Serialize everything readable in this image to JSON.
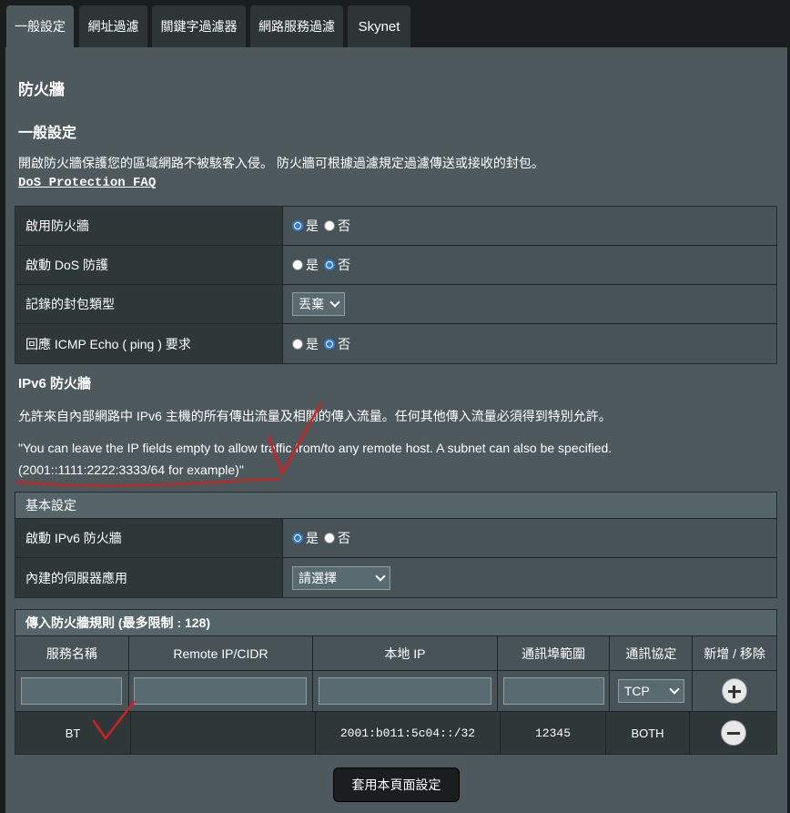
{
  "tabs": [
    "一般設定",
    "網址過濾",
    "關鍵字過濾器",
    "網路服務過濾",
    "Skynet"
  ],
  "page": {
    "title": "防火牆",
    "general_heading": "一般設定",
    "description": "開啟防火牆保護您的區域網路不被駭客入侵。 防火牆可根據過濾規定過濾傳送或接收的封包。",
    "faq_link": "DoS Protection FAQ"
  },
  "general_settings": [
    {
      "label": "啟用防火牆",
      "type": "radio",
      "options": [
        "是",
        "否"
      ],
      "selected": "是"
    },
    {
      "label": "啟動 DoS 防護",
      "type": "radio",
      "options": [
        "是",
        "否"
      ],
      "selected": "否"
    },
    {
      "label": "記錄的封包類型",
      "type": "select",
      "value": "丟棄"
    },
    {
      "label": "回應 ICMP Echo ( ping ) 要求",
      "type": "radio",
      "options": [
        "是",
        "否"
      ],
      "selected": "否"
    }
  ],
  "ipv6": {
    "heading": "IPv6 防火牆",
    "description": "允許來自內部網路中 IPv6 主機的所有傳出流量及相關的傳入流量。任何其他傳入流量必須得到特別允許。",
    "note_line1": "\"You can leave the IP fields empty to allow traffic from/to any remote host. A subnet can also be specified.",
    "note_line2": "(2001::1111:2222:3333/64 for example)\""
  },
  "basic_settings": {
    "header": "基本設定",
    "rows": [
      {
        "label": "啟動 IPv6 防火牆",
        "type": "radio",
        "options": [
          "是",
          "否"
        ],
        "selected": "是"
      },
      {
        "label": "內建的伺服器應用",
        "type": "select",
        "value": "請選擇"
      }
    ]
  },
  "rules": {
    "header": "傳入防火牆規則 (最多限制 :  128)",
    "columns": [
      "服務名稱",
      "Remote IP/CIDR",
      "本地 IP",
      "通訊埠範圍",
      "通訊協定",
      "新增 / 移除"
    ],
    "protocol_default": "TCP",
    "entries": [
      {
        "service": "BT",
        "remote": "",
        "local": "2001:b011:5c04::/32",
        "port": "12345",
        "protocol": "BOTH"
      }
    ]
  },
  "apply_button": "套用本頁面設定",
  "colors": {
    "panel": "#4d595d",
    "annotation": "#d42020",
    "radio_selected": "#2f7bd8"
  }
}
